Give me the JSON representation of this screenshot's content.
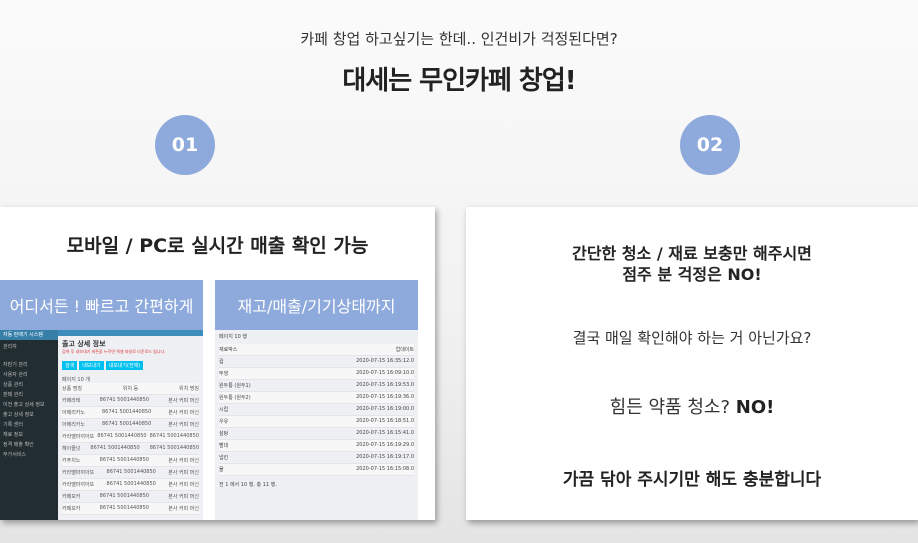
{
  "header": {
    "subtitle": "카페 창업 하고싶기는 한데.. 인건비가 걱정된다면?",
    "title": "대세는 무인카페 창업!"
  },
  "steps": [
    "01",
    "02"
  ],
  "left_card": {
    "heading": "모바일 / PC로 실시간 매출 확인 가능",
    "panel1": {
      "label": "어디서든 ! 빠르고 간편하게",
      "app": {
        "brand": "자동 판매기 시스템",
        "user": "관리자",
        "menu": [
          "자판기 관리",
          "사용자 관리",
          "상품 관리",
          "판매 관리",
          "이전 출고 상세 정보",
          "출고 상세 정보",
          "기록 센터",
          "재료 정보",
          "정격 매출 확인",
          "부가서비스"
        ],
        "page_title": "출고 상세 정보",
        "notice": "검색 후 내보내기 버튼을 누르면 엑셀 파일로 다운로드 됩니다.",
        "buttons": [
          "검색",
          "내보내기",
          "내보내기(전체)"
        ],
        "per_page": "페이지 10 개",
        "columns": [
          "상품 명칭",
          "위치 등",
          "위치 명칭"
        ],
        "rows": [
          [
            "카페라테",
            "86741 5001440850",
            "본사 커피 머신"
          ],
          [
            "아메리카노",
            "86741 5001440850",
            "본사 커피 머신"
          ],
          [
            "아메리카노",
            "86741 5001440850",
            "본사 커피 머신"
          ],
          [
            "카라멜마끼아또",
            "86741 5001440850",
            "86741 5001440850"
          ],
          [
            "헤이즐넛",
            "86741 5001440850",
            "86741 5001440850"
          ],
          [
            "카푸치노",
            "86741 5001440850",
            "본사 커피 머신"
          ],
          [
            "카라멜마끼아또",
            "86741 5001440850",
            "본사 커피 머신"
          ],
          [
            "카라멜마끼아또",
            "86741 5001440850",
            "본사 커피 머신"
          ],
          [
            "카페모카",
            "86741 5001440850",
            "본사 커피 머신"
          ],
          [
            "카페모카",
            "86741 5001440850",
            "본사 커피 머신"
          ]
        ]
      }
    },
    "panel2": {
      "label": "재고/매출/기기상태까지",
      "per_page": "페이지 10 행",
      "columns": [
        "재료박스",
        "업데이트"
      ],
      "rows": [
        [
          "컵",
          "2020-07-15 16:35:12.0"
        ],
        [
          "뚜껑",
          "2020-07-15 16:09:10.0"
        ],
        [
          "원두통 (원두1)",
          "2020-07-15 16:19:53.0"
        ],
        [
          "원두통 (원두2)",
          "2020-07-15 16:19:36.0"
        ],
        [
          "시럽",
          "2020-07-15 16:19:00.0"
        ],
        [
          "우유",
          "2020-07-15 16:18:51.0"
        ],
        [
          "설탕",
          "2020-07-15 16:15:41.0"
        ],
        [
          "빨대",
          "2020-07-15 16:19:29.0"
        ],
        [
          "냅킨",
          "2020-07-15 16:19:17.0"
        ],
        [
          "물",
          "2020-07-15 16:15:08.0"
        ]
      ],
      "footer": "전 1 에서 10 행, 총 11 행."
    }
  },
  "right_card": {
    "line1": "간단한 청소 / 재료 보충만 해주시면",
    "line2": "점주 분 걱정은 NO!",
    "question": "결국 매일 확인해야 하는 거 아닌가요?",
    "cleaning": "힘든 약품 청소?",
    "cleaning_no": "NO!",
    "closing": "가끔 닦아 주시기만 해도 충분합니다"
  },
  "colors": {
    "accent": "#8ea9db"
  }
}
